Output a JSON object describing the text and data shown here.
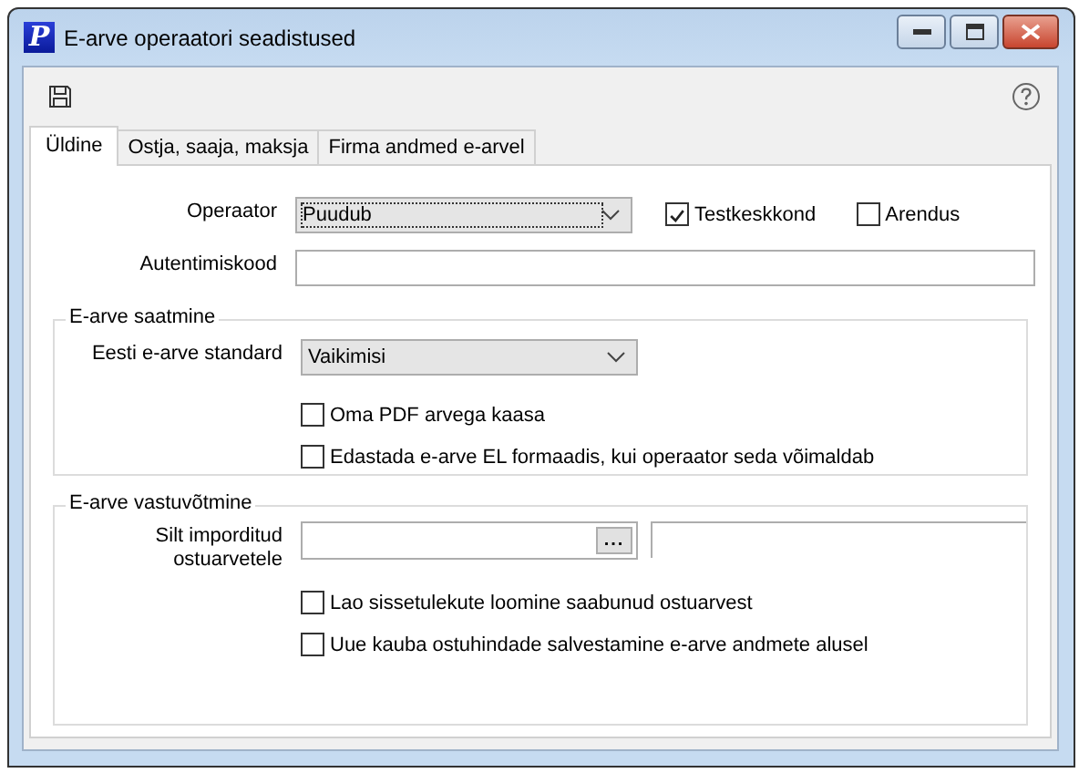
{
  "window": {
    "title": "E-arve operaatori seadistused",
    "app_letter": "P"
  },
  "tabs": [
    {
      "label": "Üldine",
      "selected": true
    },
    {
      "label": "Ostja, saaja, maksja",
      "selected": false
    },
    {
      "label": "Firma andmed e-arvel",
      "selected": false
    }
  ],
  "operator": {
    "label": "Operaator",
    "value": "Puudub",
    "options": [
      {
        "label": "Testkeskkond",
        "checked": true
      },
      {
        "label": "Arendus",
        "checked": false
      }
    ]
  },
  "auth": {
    "label": "Autentimiskood"
  },
  "sending": {
    "title": "E-arve saatmine",
    "standard_label": "Eesti e-arve standard",
    "standard_value": "Vaikimisi",
    "checks": [
      {
        "label": "Oma PDF arvega kaasa",
        "checked": false
      },
      {
        "label": "Edastada e-arve EL formaadis, kui operaator seda võimaldab",
        "checked": false
      }
    ]
  },
  "receiving": {
    "title": "E-arve vastuvõtmine",
    "tag_label": "Silt imporditud ostuarvetele",
    "browse": "...",
    "checks": [
      {
        "label": "Lao sissetulekute loomine saabunud ostuarvest",
        "checked": false
      },
      {
        "label": "Uue kauba ostuhindade salvestamine e-arve andmete alusel",
        "checked": false
      }
    ]
  }
}
